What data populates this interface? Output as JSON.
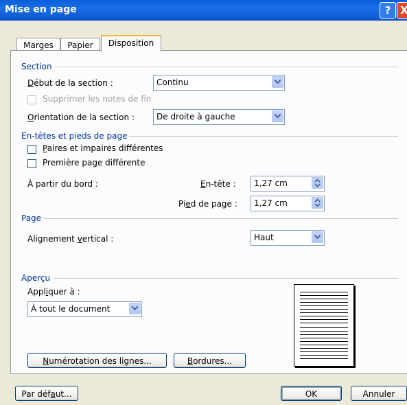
{
  "window": {
    "title": "Mise en page",
    "help_glyph": "?",
    "close_glyph": "X"
  },
  "tabs": [
    {
      "label": "Marges"
    },
    {
      "label": "Papier"
    },
    {
      "label": "Disposition"
    }
  ],
  "section": {
    "heading": "Section",
    "start_label": "Début de la section :",
    "start_value": "Continu",
    "suppress_endnotes_label": "Supprimer les notes de fin",
    "suppress_endnotes_checked": false,
    "orientation_label": "Orientation de la section :",
    "orientation_value": "De droite à gauche"
  },
  "headers": {
    "heading": "En-têtes et pieds de page",
    "odd_even_label": "Paires et impaires différentes",
    "odd_even_checked": false,
    "first_page_label": "Première page différente",
    "first_page_checked": false,
    "from_edge_label": "À partir du bord :",
    "header_label": "En-tête :",
    "header_value": "1,27 cm",
    "footer_label": "Pied de page :",
    "footer_value": "1,27 cm"
  },
  "page": {
    "heading": "Page",
    "valign_label": "Alignement vertical :",
    "valign_value": "Haut"
  },
  "preview": {
    "heading": "Aperçu",
    "apply_label": "Appliquer à :",
    "apply_value": "À tout le document"
  },
  "buttons": {
    "line_numbers": "Numérotation des lignes...",
    "borders": "Bordures...",
    "default": "Par défaut...",
    "ok": "OK",
    "cancel": "Annuler"
  }
}
